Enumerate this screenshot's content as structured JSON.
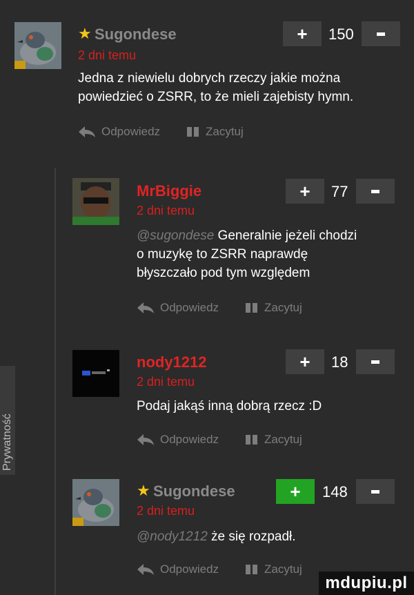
{
  "comments": [
    {
      "username": "Sugondese",
      "starred": true,
      "time": "2 dni temu",
      "mention": "",
      "lines": [
        "Jedna z niewielu dobrych rzeczy jakie można",
        "powiedzieć o ZSRR, to że mieli zajebisty hymn."
      ],
      "score": "150",
      "reply_label": "Odpowiedz",
      "quote_label": "Zacytuj"
    },
    {
      "username": "MrBiggie",
      "starred": false,
      "time": "2 dni temu",
      "mention": "@sugondese",
      "lines": [
        "Generalnie jeżeli chodzi",
        "o muzykę to ZSRR naprawdę",
        "błyszczało pod tym względem"
      ],
      "score": "77",
      "reply_label": "Odpowiedz",
      "quote_label": "Zacytuj"
    },
    {
      "username": "nody1212",
      "starred": false,
      "time": "2 dni temu",
      "mention": "",
      "lines": [
        "Podaj jakąś inną dobrą rzecz :D"
      ],
      "score": "18",
      "reply_label": "Odpowiedz",
      "quote_label": "Zacytuj"
    },
    {
      "username": "Sugondese",
      "starred": true,
      "time": "2 dni temu",
      "mention": "@nody1212",
      "lines": [
        "że się rozpadł."
      ],
      "score": "148",
      "reply_label": "Odpowiedz",
      "quote_label": "Zacytuj"
    }
  ],
  "side_tab_label": "Prywatność",
  "watermark": "mdupiu.pl",
  "colors": {
    "background": "#2b2b2b",
    "username_red": "#e02424",
    "time_red": "#d81f1f",
    "star": "#f5c518",
    "upvote_active": "#23a323",
    "vote_button": "#404040"
  },
  "icons": [
    "star-icon",
    "plus-icon",
    "minus-icon",
    "reply-arrow-icon",
    "quote-icon"
  ]
}
